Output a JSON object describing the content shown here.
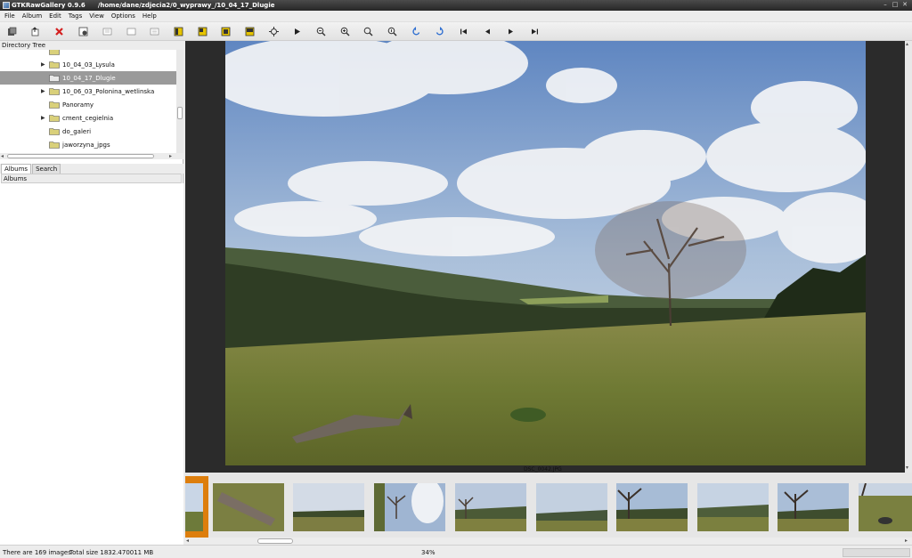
{
  "titlebar": {
    "app_name": "GTKRawGallery 0.9.6",
    "path": "/home/dane/zdjecia2/0_wyprawy_/10_04_17_Dlugie"
  },
  "menu": [
    "File",
    "Album",
    "Edit",
    "Tags",
    "View",
    "Options",
    "Help"
  ],
  "toolbar": [
    "import-icon",
    "export-icon",
    "delete-icon",
    "new-folder-icon",
    "grid-view-icon",
    "blank-view-icon",
    "list-view-icon",
    "layout-1-icon",
    "layout-2-icon",
    "layout-3-icon",
    "layout-4-icon",
    "fit-icon",
    "play-icon",
    "zoom-out-icon",
    "zoom-in-icon",
    "zoom-fit-icon",
    "zoom-100-icon",
    "rotate-left-icon",
    "rotate-right-icon",
    "first-icon",
    "prev-icon",
    "next-icon",
    "last-icon"
  ],
  "left": {
    "dir_header": "Directory Tree",
    "tree": [
      {
        "label": "10_04_03_Lysula",
        "expander": "▶",
        "selected": false
      },
      {
        "label": "10_04_17_Dlugie",
        "expander": "",
        "selected": true
      },
      {
        "label": "10_06_03_Polonina_wetlinska",
        "expander": "▶",
        "selected": false
      },
      {
        "label": "Panoramy",
        "expander": "",
        "selected": false
      },
      {
        "label": "cment_cegielnia",
        "expander": "▶",
        "selected": false
      },
      {
        "label": "do_galeri",
        "expander": "",
        "selected": false
      },
      {
        "label": "jaworzyna_jpgs",
        "expander": "",
        "selected": false
      }
    ],
    "tabs": [
      "Albums",
      "Search"
    ],
    "albums_header": "Albums"
  },
  "viewer": {
    "caption": "DSC_0042.JPG"
  },
  "status": {
    "images": "There are 169 images",
    "size": "Total size 1832.470011 MB",
    "zoom": "34%"
  },
  "colors": {
    "titlebar": "#333333",
    "selection": "#9a9a9a",
    "current_thumb": "#dd7e0d",
    "viewer_bg": "#2b2b2b"
  }
}
